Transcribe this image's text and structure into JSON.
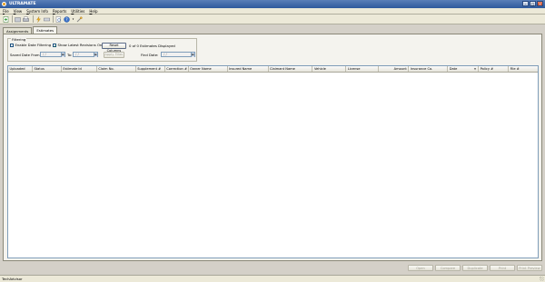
{
  "window": {
    "title": "ULTRAMATE"
  },
  "menu": [
    {
      "label": "File",
      "acc": "F",
      "rest": "ile"
    },
    {
      "label": "View",
      "acc": "V",
      "rest": "iew"
    },
    {
      "label": "System Info",
      "acc": "S",
      "rest": "ystem Info"
    },
    {
      "label": "Reports",
      "acc": "R",
      "rest": "eports"
    },
    {
      "label": "Utilities",
      "acc": "U",
      "rest": "tilities"
    },
    {
      "label": "Help",
      "acc": "H",
      "rest": "elp"
    }
  ],
  "toolbar_icons": [
    "new-icon",
    "open-icon",
    "print-icon",
    "lightning-icon",
    "keyboard-icon",
    "preview-icon",
    "help-icon",
    "tools-icon"
  ],
  "tabs": {
    "assignments": "Assignments",
    "estimates": "Estimates"
  },
  "filtering": {
    "legend": "Filtering",
    "enable_date_filtering": {
      "label": "Enable Date Filtering",
      "checked": false
    },
    "show_latest_revisions": {
      "label": "Show Latest Revisions Only",
      "checked": true
    },
    "saved_date_from_label": "Saved Date From:",
    "date_from_value": "/ /",
    "to_label": "To:",
    "date_to_value": "/ /",
    "reset_columns": "Reset Columns",
    "apply_filter": "Apply Filter",
    "estimates_displayed": "0 of 0 Estimates Displayed",
    "find_date_label": "Find Date:",
    "find_date_value": "/ /"
  },
  "grid": {
    "columns": [
      "Uploaded",
      "Status",
      "Estimate Id",
      "Claim No.",
      "Supplement #",
      "Correction #",
      "Owner Name",
      "Insured Name",
      "Claimant Name",
      "Vehicle",
      "License",
      "Amount",
      "Insurance Co.",
      "Date",
      "Policy #",
      "File #"
    ]
  },
  "bottom_buttons": [
    "Open",
    "Compare",
    "Duplicate",
    "Print",
    "Print Preview"
  ],
  "status": {
    "text": "TechAdvisor"
  }
}
